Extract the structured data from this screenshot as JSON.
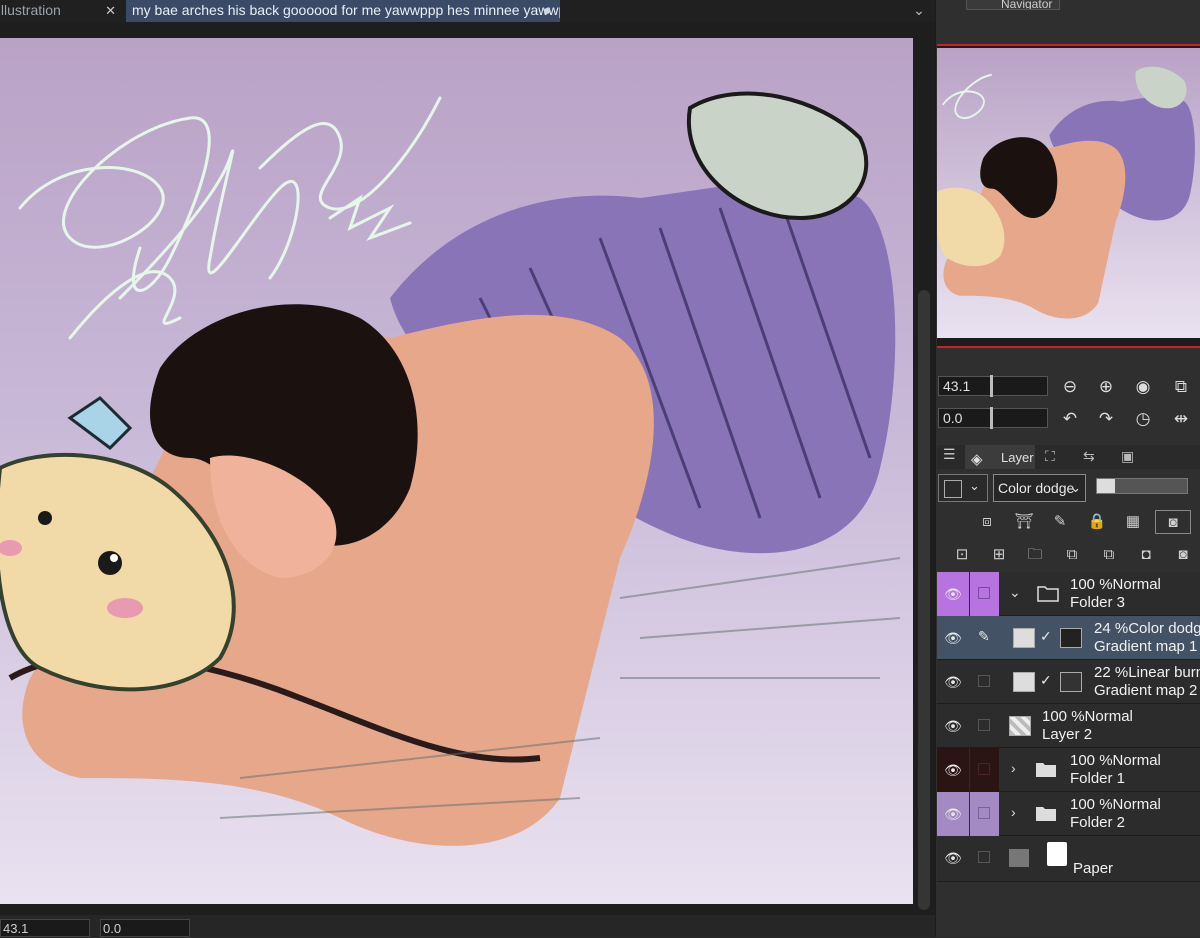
{
  "tabs": [
    {
      "label": "Illustration",
      "close": "✕"
    },
    {
      "label": "my bae arches his back goooood for me yawwppp hes minnee yawwp*"
    }
  ],
  "navigator": {
    "title": "Navigator"
  },
  "nav_controls": {
    "zoom": "43.1",
    "angle": "0.0"
  },
  "status": {
    "zoom": "43.1",
    "angle": "0.0"
  },
  "layer_panel": {
    "tab_label": "Layer",
    "blend_mode": "Color dodge",
    "layers": [
      {
        "opacity": "100 %",
        "mode": "Normal",
        "name": "Folder 3",
        "kind": "folder",
        "expanded": true,
        "color": "#b774e0"
      },
      {
        "opacity": "24 %",
        "mode": "Color dodge",
        "name": "Gradient map 1",
        "kind": "adjust",
        "selected": true
      },
      {
        "opacity": "22 %",
        "mode": "Linear burn",
        "name": "Gradient map 2",
        "kind": "adjust"
      },
      {
        "opacity": "100 %",
        "mode": "Normal",
        "name": "Layer 2",
        "kind": "raster"
      },
      {
        "opacity": "100 %",
        "mode": "Normal",
        "name": "Folder 1",
        "kind": "folder",
        "expanded": false,
        "color": "#2a1414"
      },
      {
        "opacity": "100 %",
        "mode": "Normal",
        "name": "Folder 2",
        "kind": "folder",
        "expanded": false,
        "color": "#a48ac2"
      },
      {
        "opacity": "",
        "mode": "",
        "name": "Paper",
        "kind": "paper"
      }
    ]
  },
  "icons": {
    "nav_zoom": [
      "zoom-out-icon",
      "zoom-in-icon",
      "fit-icon",
      "flip-icon"
    ],
    "nav_rotate": [
      "rotate-left-icon",
      "rotate-right-icon",
      "reset-rotation-icon",
      "flip-horizontal-icon"
    ]
  },
  "colors": {
    "accent": "#3b4a66",
    "selected_layer": "#445266",
    "nav_border": "#cc2222"
  }
}
